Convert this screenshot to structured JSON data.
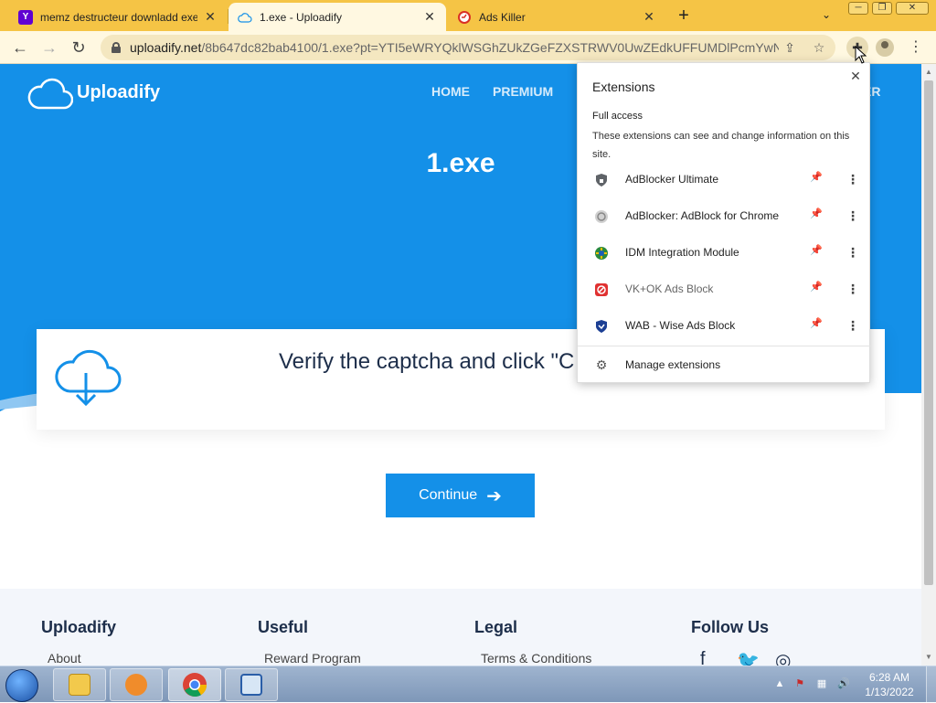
{
  "browser": {
    "tabs": [
      {
        "title": "memz destructeur downladd exe",
        "icon": "yahoo-icon",
        "active": false
      },
      {
        "title": "1.exe - Uploadify",
        "icon": "cloud-icon",
        "active": true
      },
      {
        "title": "Ads Killer",
        "icon": "ads-killer-icon",
        "active": false
      }
    ],
    "url_host": "uploadify.net",
    "url_path": "/8b647dc82bab4100/1.exe?pt=YTI5eWRYQklWSGhZUkZGeFZXSTRWV0UwZEdkUFFUMDlPcmYwN2..."
  },
  "site": {
    "logo_text": "Uploadify",
    "nav": [
      "HOME",
      "PREMIUM",
      "ER"
    ],
    "file_title": "1.exe",
    "card_text": "Verify the captcha and click \"C",
    "continue_label": "Continue",
    "footer": [
      {
        "heading": "Uploadify",
        "link": "About"
      },
      {
        "heading": "Useful",
        "link": "Reward Program"
      },
      {
        "heading": "Legal",
        "link": "Terms & Conditions"
      },
      {
        "heading": "Follow Us",
        "link": ""
      }
    ],
    "brand_color": "#1490e8"
  },
  "extensions_popup": {
    "title": "Extensions",
    "section_heading": "Full access",
    "section_desc": "These extensions can see and change information on this site.",
    "items": [
      {
        "name": "AdBlocker Ultimate",
        "icon": "shield-icon"
      },
      {
        "name": "AdBlocker: AdBlock for Chrome",
        "icon": "adblock-icon"
      },
      {
        "name": "IDM Integration Module",
        "icon": "idm-icon"
      },
      {
        "name": "VK+OK Ads Block",
        "icon": "block-icon"
      },
      {
        "name": "WAB - Wise Ads Block",
        "icon": "wab-shield-icon"
      }
    ],
    "manage_label": "Manage extensions"
  },
  "taskbar": {
    "time": "6:28 AM",
    "date": "1/13/2022",
    "apps": [
      "file-explorer",
      "media-player",
      "chrome",
      "remote-desktop"
    ]
  }
}
